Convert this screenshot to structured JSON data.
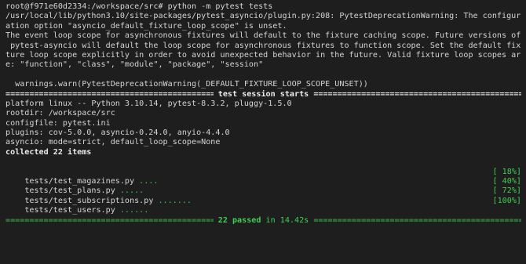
{
  "terminal": {
    "prompt": "root@f971e60d2334:/workspace/src# python -m pytest tests",
    "warning_lines": [
      "/usr/local/lib/python3.10/site-packages/pytest_asyncio/plugin.py:208: PytestDeprecationWarning: The configur",
      "ation option \"asyncio_default_fixture_loop_scope\" is unset.",
      "The event loop scope for asynchronous fixtures will default to the fixture caching scope. Future versions of",
      " pytest-asyncio will default the loop scope for asynchronous fixtures to function scope. Set the default fix",
      "ture loop scope explicitly in order to avoid unexpected behavior in the future. Valid fixture loop scopes ar",
      "e: \"function\", \"class\", \"module\", \"package\", \"session\""
    ],
    "warn_call": "  warnings.warn(PytestDeprecationWarning(_DEFAULT_FIXTURE_LOOP_SCOPE_UNSET))",
    "session_header": " test session starts ",
    "session_info": [
      "platform linux -- Python 3.10.14, pytest-8.3.2, pluggy-1.5.0",
      "rootdir: /workspace/src",
      "configfile: pytest.ini",
      "plugins: cov-5.0.0, asyncio-0.24.0, anyio-4.4.0",
      "asyncio: mode=strict, default_loop_scope=None"
    ],
    "collected": "collected 22 items",
    "tests": [
      {
        "file": "tests/test_magazines.py",
        "dots": " ....",
        "percent": "[ 18%]"
      },
      {
        "file": "tests/test_plans.py",
        "dots": " .....",
        "percent": "[ 40%]"
      },
      {
        "file": "tests/test_subscriptions.py",
        "dots": " .......",
        "percent": "[ 72%]"
      },
      {
        "file": "tests/test_users.py",
        "dots": " ......",
        "percent": "[100%]"
      }
    ],
    "summary": {
      "passed": "22 passed",
      "duration": " in 14.42s "
    },
    "colors": {
      "background": "#1e1e1e",
      "text": "#d4d4d4",
      "pass_green": "#3fcf52"
    }
  }
}
